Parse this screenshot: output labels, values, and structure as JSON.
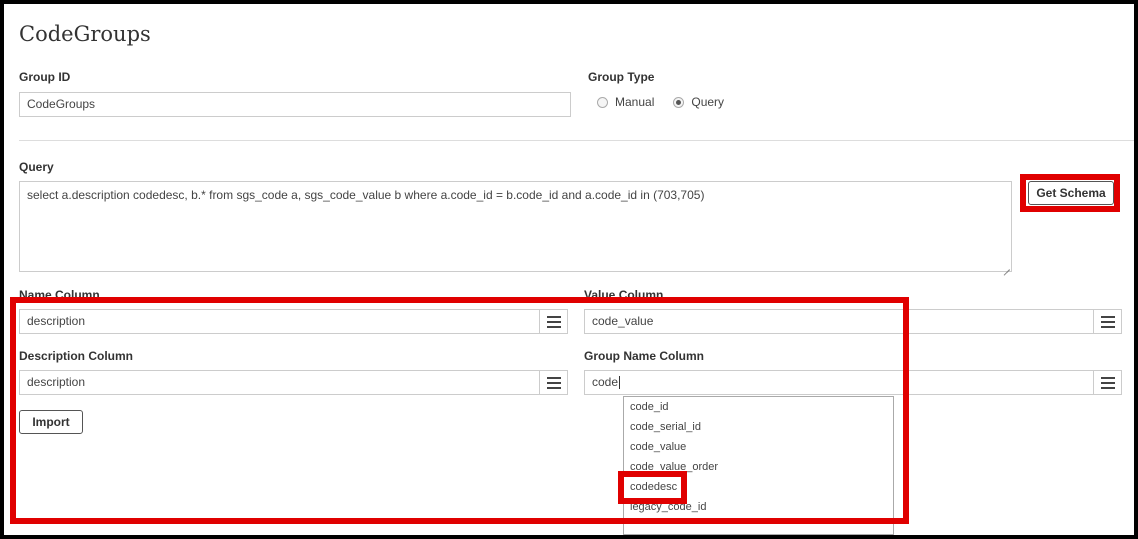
{
  "page": {
    "title": "CodeGroups"
  },
  "group_id": {
    "label": "Group ID",
    "value": "CodeGroups"
  },
  "group_type": {
    "label": "Group Type",
    "options": [
      {
        "label": "Manual",
        "checked": false
      },
      {
        "label": "Query",
        "checked": true
      }
    ]
  },
  "query": {
    "label": "Query",
    "value": "select a.description codedesc, b.* from sgs_code a, sgs_code_value b where a.code_id = b.code_id and a.code_id in (703,705)",
    "get_schema_label": "Get Schema"
  },
  "name_column": {
    "label": "Name Column",
    "value": "description"
  },
  "value_column": {
    "label": "Value Column",
    "value": "code_value"
  },
  "description_column": {
    "label": "Description Column",
    "value": "description"
  },
  "group_name_column": {
    "label": "Group Name Column",
    "value": "code"
  },
  "import_label": "Import",
  "dropdown": {
    "items": [
      "code_id",
      "code_serial_id",
      "code_value",
      "code_value_order",
      "codedesc",
      "legacy_code_id"
    ]
  },
  "colors": {
    "highlight": "#e00000"
  }
}
